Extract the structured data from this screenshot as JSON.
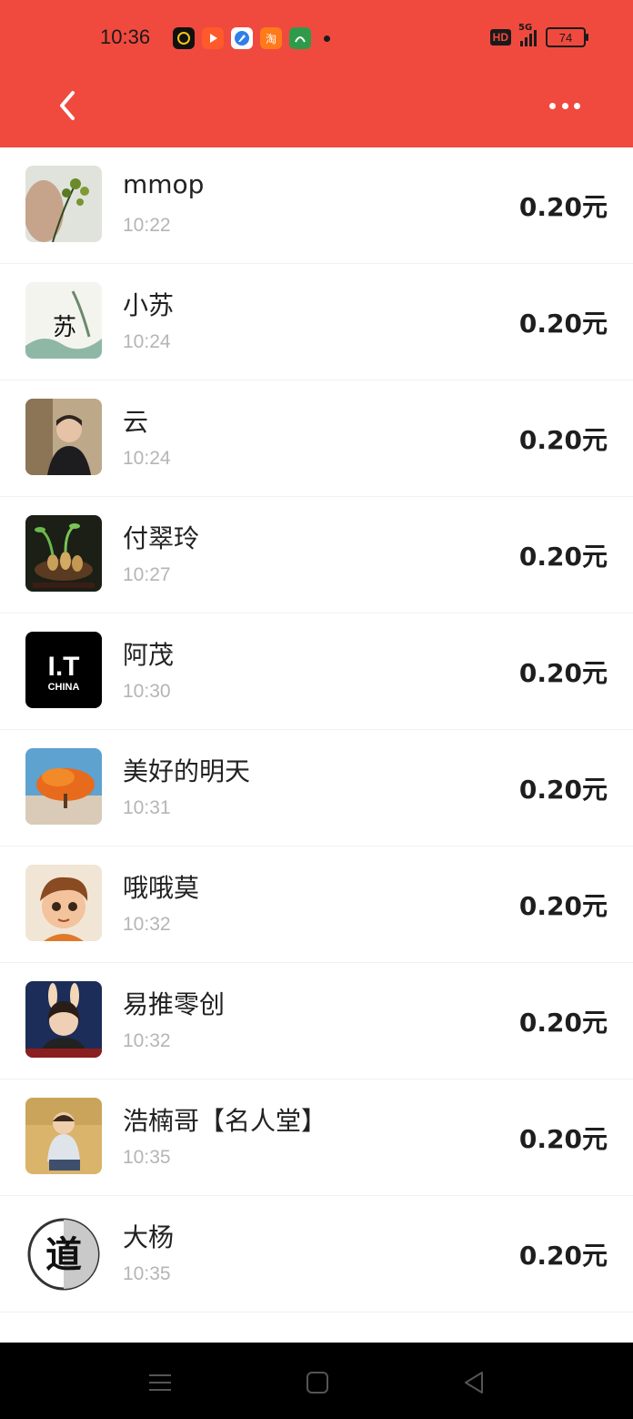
{
  "status_bar": {
    "time": "10:36",
    "network": "5G",
    "hd": "HD",
    "battery": "74",
    "app_icons": [
      "clock-app-icon",
      "video-app-icon",
      "browser-app-icon",
      "taobao-icon",
      "maps-app-icon"
    ],
    "taobao_label": "淘"
  },
  "header": {
    "background": "#f04a3e"
  },
  "items": [
    {
      "name": "mmop",
      "time": "10:22",
      "amount": "0.20元",
      "avatar": "flower-photo"
    },
    {
      "name": "小苏",
      "time": "10:24",
      "amount": "0.20元",
      "avatar": "ink-painting"
    },
    {
      "name": "云",
      "time": "10:24",
      "amount": "0.20元",
      "avatar": "boy-car-photo"
    },
    {
      "name": "付翠玲",
      "time": "10:27",
      "amount": "0.20元",
      "avatar": "sprout-photo"
    },
    {
      "name": "阿茂",
      "time": "10:30",
      "amount": "0.20元",
      "avatar": "it-china-logo"
    },
    {
      "name": "美好的明天",
      "time": "10:31",
      "amount": "0.20元",
      "avatar": "tree-photo"
    },
    {
      "name": "哦哦莫",
      "time": "10:32",
      "amount": "0.20元",
      "avatar": "cartoon-boy"
    },
    {
      "name": "易推零创",
      "time": "10:32",
      "amount": "0.20元",
      "avatar": "bunny-ears-photo"
    },
    {
      "name": "浩楠哥【名人堂】",
      "time": "10:35",
      "amount": "0.20元",
      "avatar": "baby-photo"
    },
    {
      "name": "大杨",
      "time": "10:35",
      "amount": "0.20元",
      "avatar": "dao-calligraphy"
    }
  ],
  "avatar_text": {
    "it_top": "I.T",
    "it_bottom": "CHINA",
    "dao": "道",
    "su": "苏"
  }
}
